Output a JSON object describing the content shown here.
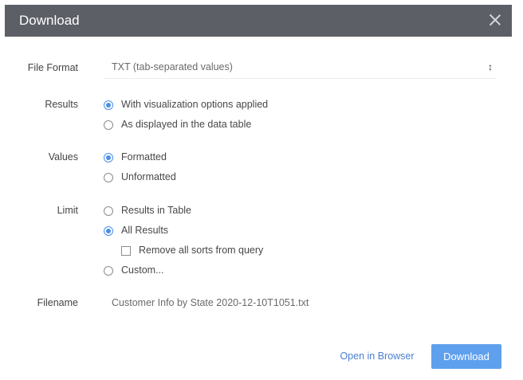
{
  "dialog": {
    "title": "Download",
    "close_icon": "close-icon"
  },
  "file_format": {
    "label": "File Format",
    "selected": "TXT (tab-separated values)",
    "arrow_icon": "select-updown-icon"
  },
  "results": {
    "label": "Results",
    "options": [
      {
        "label": "With visualization options applied",
        "checked": true
      },
      {
        "label": "As displayed in the data table",
        "checked": false
      }
    ]
  },
  "values": {
    "label": "Values",
    "options": [
      {
        "label": "Formatted",
        "checked": true
      },
      {
        "label": "Unformatted",
        "checked": false
      }
    ]
  },
  "limit": {
    "label": "Limit",
    "options": [
      {
        "label": "Results in Table",
        "checked": false
      },
      {
        "label": "All Results",
        "checked": true
      },
      {
        "label": "Custom...",
        "checked": false
      }
    ],
    "remove_sorts": {
      "label": "Remove all sorts from query",
      "checked": false
    }
  },
  "filename": {
    "label": "Filename",
    "value": "Customer Info by State 2020-12-10T1051.txt"
  },
  "buttons": {
    "open_in_browser": "Open in Browser",
    "download": "Download"
  },
  "colors": {
    "titlebar": "#5c5f66",
    "accent": "#4a8fe7",
    "primary_button": "#5fa0ee"
  }
}
